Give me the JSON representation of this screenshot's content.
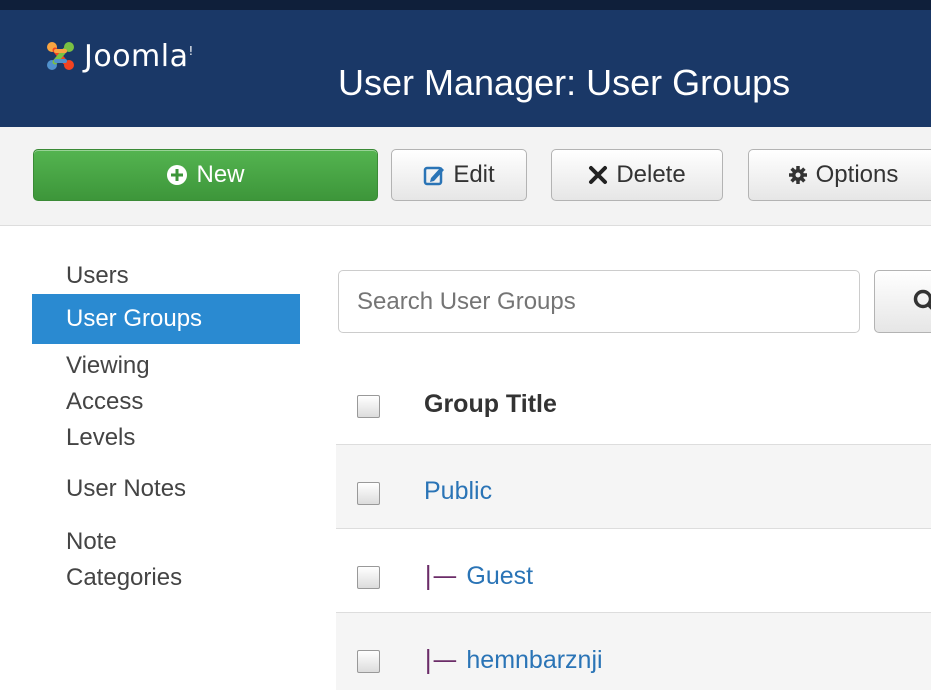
{
  "header": {
    "logo_text": "Joomla!",
    "page_title": "User Manager: User Groups"
  },
  "toolbar": {
    "new_label": "New",
    "edit_label": "Edit",
    "delete_label": "Delete",
    "options_label": "Options"
  },
  "sidebar": {
    "items": [
      {
        "label": "Users",
        "active": false
      },
      {
        "label": "User Groups",
        "active": true
      },
      {
        "label": "Viewing Access Levels",
        "active": false
      },
      {
        "label": "User Notes",
        "active": false
      },
      {
        "label": "Note Categories",
        "active": false
      }
    ]
  },
  "search": {
    "placeholder": "Search User Groups"
  },
  "table": {
    "column_title": "Group Title",
    "rows": [
      {
        "title": "Public",
        "level": 0
      },
      {
        "title": "Guest",
        "level": 1,
        "prefix": "|—"
      },
      {
        "title": "hemnbarznji",
        "level": 1,
        "prefix": "|—"
      }
    ]
  },
  "colors": {
    "header_bg": "#1a3867",
    "new_button": "#46a546",
    "active_nav": "#2a8ad1",
    "link": "#2a74b6",
    "tree_prefix": "#6b2c68"
  }
}
